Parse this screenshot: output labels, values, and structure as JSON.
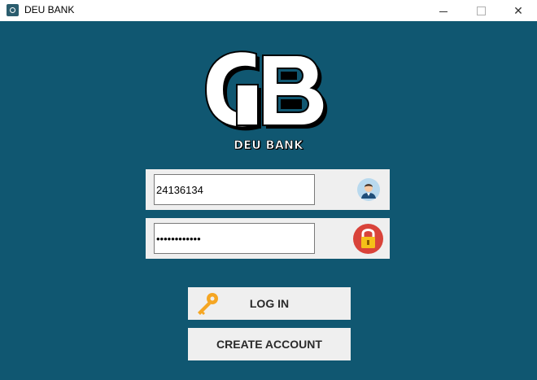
{
  "window": {
    "title": "DEU BANK"
  },
  "brand": {
    "name": "DEU BANK"
  },
  "login": {
    "username_value": "24136134",
    "password_value": "••••••••••••",
    "login_label": "LOG IN",
    "create_label": "CREATE ACCOUNT"
  },
  "icons": {
    "app": "app-icon",
    "user": "user-avatar-icon",
    "lock": "padlock-icon",
    "key": "key-icon",
    "logo": "gb-logo"
  },
  "colors": {
    "background": "#105771",
    "panel": "#efefef",
    "lock_red": "#d9433a",
    "lock_yellow": "#f5c018",
    "key": "#f5a623"
  }
}
